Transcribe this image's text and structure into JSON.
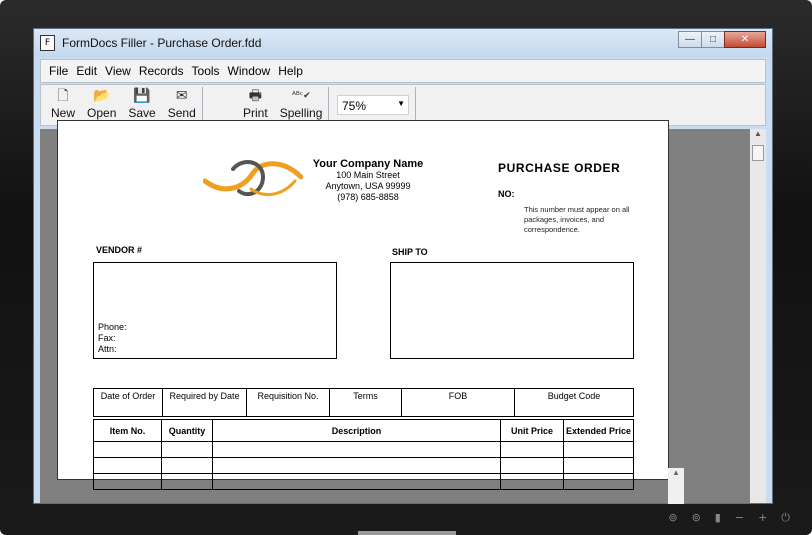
{
  "window": {
    "title": "FormDocs Filler - Purchase Order.fdd",
    "controls": {
      "minimize": "—",
      "maximize": "□",
      "close": "✕"
    }
  },
  "menu": [
    {
      "label": "File"
    },
    {
      "label": "Edit"
    },
    {
      "label": "View"
    },
    {
      "label": "Records"
    },
    {
      "label": "Tools"
    },
    {
      "label": "Window"
    },
    {
      "label": "Help"
    }
  ],
  "toolbar": {
    "new": {
      "label": "New",
      "icon": "new-document-icon"
    },
    "open": {
      "label": "Open",
      "icon": "open-folder-icon"
    },
    "save": {
      "label": "Save",
      "icon": "save-disk-icon"
    },
    "send": {
      "label": "Send",
      "icon": "send-icon"
    },
    "print": {
      "label": "Print",
      "icon": "printer-icon"
    },
    "spelling": {
      "label": "Spelling",
      "icon": "spellcheck-icon"
    },
    "zoom": "75%"
  },
  "form": {
    "company_name": "Your Company Name",
    "address1": "100 Main Street",
    "address2": "Anytown, USA 99999",
    "phone": "(978) 685-8858",
    "title": "PURCHASE ORDER",
    "no_label": "NO:",
    "note": "This number must appear on all packages, invoices, and correspondence.",
    "vendor_label": "VENDOR #",
    "ship_to_label": "SHIP TO",
    "vendor_phone": "Phone:",
    "vendor_fax": "Fax:",
    "vendor_attn": "Attn:",
    "order_headers": [
      "Date of Order",
      "Required by Date",
      "Requisition No.",
      "Terms",
      "FOB",
      "Budget Code"
    ],
    "item_headers": [
      "Item No.",
      "Quantity",
      "Description",
      "Unit Price",
      "Extended Price"
    ],
    "logo_colors": {
      "orange": "#f0a020",
      "gray": "#555555"
    }
  },
  "bezel_icons": [
    "⊚",
    "⊚",
    "▮",
    "−",
    "+",
    "⏻"
  ]
}
